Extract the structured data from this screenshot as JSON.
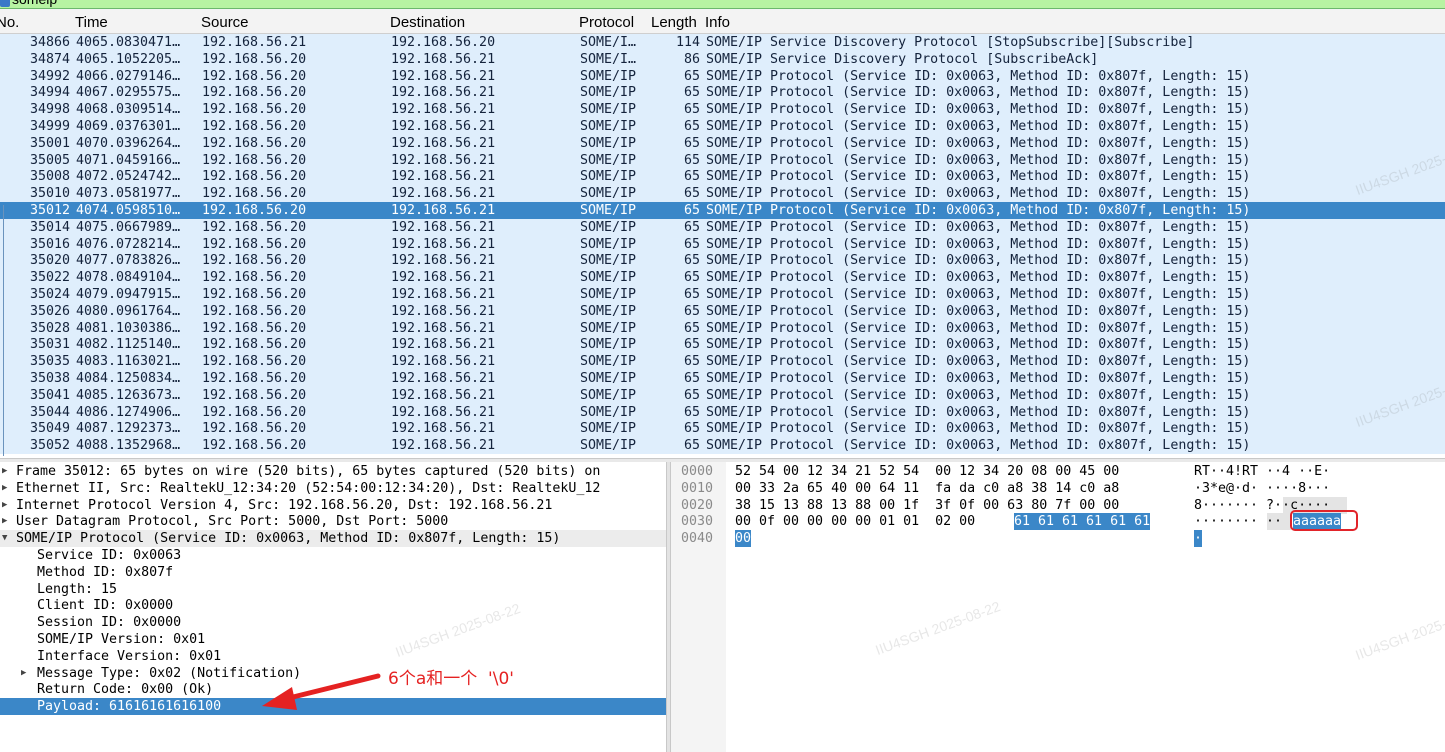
{
  "filter": {
    "value": "someip"
  },
  "columns": [
    "No.",
    "Time",
    "Source",
    "Destination",
    "Protocol",
    "Length",
    "Info"
  ],
  "packets": [
    {
      "no": "34866",
      "time": "4065.0830471…",
      "src": "192.168.56.21",
      "dst": "192.168.56.20",
      "proto": "SOME/I…",
      "len": "114",
      "info": "SOME/IP Service Discovery Protocol [StopSubscribe][Subscribe]"
    },
    {
      "no": "34874",
      "time": "4065.1052205…",
      "src": "192.168.56.20",
      "dst": "192.168.56.21",
      "proto": "SOME/I…",
      "len": "86",
      "info": "SOME/IP Service Discovery Protocol [SubscribeAck]"
    },
    {
      "no": "34992",
      "time": "4066.0279146…",
      "src": "192.168.56.20",
      "dst": "192.168.56.21",
      "proto": "SOME/IP",
      "len": "65",
      "info": "SOME/IP Protocol (Service ID: 0x0063, Method ID: 0x807f, Length: 15)"
    },
    {
      "no": "34994",
      "time": "4067.0295575…",
      "src": "192.168.56.20",
      "dst": "192.168.56.21",
      "proto": "SOME/IP",
      "len": "65",
      "info": "SOME/IP Protocol (Service ID: 0x0063, Method ID: 0x807f, Length: 15)"
    },
    {
      "no": "34998",
      "time": "4068.0309514…",
      "src": "192.168.56.20",
      "dst": "192.168.56.21",
      "proto": "SOME/IP",
      "len": "65",
      "info": "SOME/IP Protocol (Service ID: 0x0063, Method ID: 0x807f, Length: 15)"
    },
    {
      "no": "34999",
      "time": "4069.0376301…",
      "src": "192.168.56.20",
      "dst": "192.168.56.21",
      "proto": "SOME/IP",
      "len": "65",
      "info": "SOME/IP Protocol (Service ID: 0x0063, Method ID: 0x807f, Length: 15)"
    },
    {
      "no": "35001",
      "time": "4070.0396264…",
      "src": "192.168.56.20",
      "dst": "192.168.56.21",
      "proto": "SOME/IP",
      "len": "65",
      "info": "SOME/IP Protocol (Service ID: 0x0063, Method ID: 0x807f, Length: 15)"
    },
    {
      "no": "35005",
      "time": "4071.0459166…",
      "src": "192.168.56.20",
      "dst": "192.168.56.21",
      "proto": "SOME/IP",
      "len": "65",
      "info": "SOME/IP Protocol (Service ID: 0x0063, Method ID: 0x807f, Length: 15)"
    },
    {
      "no": "35008",
      "time": "4072.0524742…",
      "src": "192.168.56.20",
      "dst": "192.168.56.21",
      "proto": "SOME/IP",
      "len": "65",
      "info": "SOME/IP Protocol (Service ID: 0x0063, Method ID: 0x807f, Length: 15)"
    },
    {
      "no": "35010",
      "time": "4073.0581977…",
      "src": "192.168.56.20",
      "dst": "192.168.56.21",
      "proto": "SOME/IP",
      "len": "65",
      "info": "SOME/IP Protocol (Service ID: 0x0063, Method ID: 0x807f, Length: 15)"
    },
    {
      "no": "35012",
      "time": "4074.0598510…",
      "src": "192.168.56.20",
      "dst": "192.168.56.21",
      "proto": "SOME/IP",
      "len": "65",
      "info": "SOME/IP Protocol (Service ID: 0x0063, Method ID: 0x807f, Length: 15)"
    },
    {
      "no": "35014",
      "time": "4075.0667989…",
      "src": "192.168.56.20",
      "dst": "192.168.56.21",
      "proto": "SOME/IP",
      "len": "65",
      "info": "SOME/IP Protocol (Service ID: 0x0063, Method ID: 0x807f, Length: 15)"
    },
    {
      "no": "35016",
      "time": "4076.0728214…",
      "src": "192.168.56.20",
      "dst": "192.168.56.21",
      "proto": "SOME/IP",
      "len": "65",
      "info": "SOME/IP Protocol (Service ID: 0x0063, Method ID: 0x807f, Length: 15)"
    },
    {
      "no": "35020",
      "time": "4077.0783826…",
      "src": "192.168.56.20",
      "dst": "192.168.56.21",
      "proto": "SOME/IP",
      "len": "65",
      "info": "SOME/IP Protocol (Service ID: 0x0063, Method ID: 0x807f, Length: 15)"
    },
    {
      "no": "35022",
      "time": "4078.0849104…",
      "src": "192.168.56.20",
      "dst": "192.168.56.21",
      "proto": "SOME/IP",
      "len": "65",
      "info": "SOME/IP Protocol (Service ID: 0x0063, Method ID: 0x807f, Length: 15)"
    },
    {
      "no": "35024",
      "time": "4079.0947915…",
      "src": "192.168.56.20",
      "dst": "192.168.56.21",
      "proto": "SOME/IP",
      "len": "65",
      "info": "SOME/IP Protocol (Service ID: 0x0063, Method ID: 0x807f, Length: 15)"
    },
    {
      "no": "35026",
      "time": "4080.0961764…",
      "src": "192.168.56.20",
      "dst": "192.168.56.21",
      "proto": "SOME/IP",
      "len": "65",
      "info": "SOME/IP Protocol (Service ID: 0x0063, Method ID: 0x807f, Length: 15)"
    },
    {
      "no": "35028",
      "time": "4081.1030386…",
      "src": "192.168.56.20",
      "dst": "192.168.56.21",
      "proto": "SOME/IP",
      "len": "65",
      "info": "SOME/IP Protocol (Service ID: 0x0063, Method ID: 0x807f, Length: 15)"
    },
    {
      "no": "35031",
      "time": "4082.1125140…",
      "src": "192.168.56.20",
      "dst": "192.168.56.21",
      "proto": "SOME/IP",
      "len": "65",
      "info": "SOME/IP Protocol (Service ID: 0x0063, Method ID: 0x807f, Length: 15)"
    },
    {
      "no": "35035",
      "time": "4083.1163021…",
      "src": "192.168.56.20",
      "dst": "192.168.56.21",
      "proto": "SOME/IP",
      "len": "65",
      "info": "SOME/IP Protocol (Service ID: 0x0063, Method ID: 0x807f, Length: 15)"
    },
    {
      "no": "35038",
      "time": "4084.1250834…",
      "src": "192.168.56.20",
      "dst": "192.168.56.21",
      "proto": "SOME/IP",
      "len": "65",
      "info": "SOME/IP Protocol (Service ID: 0x0063, Method ID: 0x807f, Length: 15)"
    },
    {
      "no": "35041",
      "time": "4085.1263673…",
      "src": "192.168.56.20",
      "dst": "192.168.56.21",
      "proto": "SOME/IP",
      "len": "65",
      "info": "SOME/IP Protocol (Service ID: 0x0063, Method ID: 0x807f, Length: 15)"
    },
    {
      "no": "35044",
      "time": "4086.1274906…",
      "src": "192.168.56.20",
      "dst": "192.168.56.21",
      "proto": "SOME/IP",
      "len": "65",
      "info": "SOME/IP Protocol (Service ID: 0x0063, Method ID: 0x807f, Length: 15)"
    },
    {
      "no": "35049",
      "time": "4087.1292373…",
      "src": "192.168.56.20",
      "dst": "192.168.56.21",
      "proto": "SOME/IP",
      "len": "65",
      "info": "SOME/IP Protocol (Service ID: 0x0063, Method ID: 0x807f, Length: 15)"
    },
    {
      "no": "35052",
      "time": "4088.1352968…",
      "src": "192.168.56.20",
      "dst": "192.168.56.21",
      "proto": "SOME/IP",
      "len": "65",
      "info": "SOME/IP Protocol (Service ID: 0x0063, Method ID: 0x807f, Length: 15)"
    }
  ],
  "selected_packet_index": 10,
  "details": [
    {
      "text": "Frame 35012: 65 bytes on wire (520 bits), 65 bytes captured (520 bits) on",
      "level": 0,
      "arrow": "collapsed"
    },
    {
      "text": "Ethernet II, Src: RealtekU_12:34:20 (52:54:00:12:34:20), Dst: RealtekU_12",
      "level": 0,
      "arrow": "collapsed"
    },
    {
      "text": "Internet Protocol Version 4, Src: 192.168.56.20, Dst: 192.168.56.21",
      "level": 0,
      "arrow": "collapsed"
    },
    {
      "text": "User Datagram Protocol, Src Port: 5000, Dst Port: 5000",
      "level": 0,
      "arrow": "collapsed"
    },
    {
      "text": "SOME/IP Protocol (Service ID: 0x0063, Method ID: 0x807f, Length: 15)",
      "level": 0,
      "arrow": "expanded"
    },
    {
      "text": "Service ID: 0x0063",
      "level": 1,
      "arrow": "none"
    },
    {
      "text": "Method ID: 0x807f",
      "level": 1,
      "arrow": "none"
    },
    {
      "text": "Length: 15",
      "level": 1,
      "arrow": "none"
    },
    {
      "text": "Client ID: 0x0000",
      "level": 1,
      "arrow": "none"
    },
    {
      "text": "Session ID: 0x0000",
      "level": 1,
      "arrow": "none"
    },
    {
      "text": "SOME/IP Version: 0x01",
      "level": 1,
      "arrow": "none"
    },
    {
      "text": "Interface Version: 0x01",
      "level": 1,
      "arrow": "none"
    },
    {
      "text": "Message Type: 0x02 (Notification)",
      "level": 1,
      "arrow": "collapsed"
    },
    {
      "text": "Return Code: 0x00 (Ok)",
      "level": 1,
      "arrow": "none"
    },
    {
      "text": "Payload: 61616161616100",
      "level": 1,
      "arrow": "none"
    }
  ],
  "selected_detail_index": 14,
  "bytes": [
    {
      "offset": "0000",
      "hex": "52 54 00 12 34 21 52 54  00 12 34 20 08 00 45 00",
      "ascii": "RT··4!RT ··4 ··E·",
      "hex_sel": "",
      "ascii_sel": ""
    },
    {
      "offset": "0010",
      "hex": "00 33 2a 65 40 00 64 11  fa da c0 a8 38 14 c0 a8",
      "ascii": "·3*e@·d· ····8···",
      "hex_sel": "",
      "ascii_sel": ""
    },
    {
      "offset": "0020",
      "hex": "38 15 13 88 13 88 00 1f  3f 0f 00 63 80 7f 00 00",
      "ascii": "8······· ?··c····",
      "hex_sel": "",
      "ascii_sel": ""
    },
    {
      "offset": "0030",
      "hex": "00 0f 00 00 00 00 01 01  02 00 ",
      "ascii": "········ ··",
      "hex_sel": "61 61 61 61 61 61",
      "ascii_sel": "aaaaaa"
    },
    {
      "offset": "0040",
      "hex": "",
      "ascii": "",
      "hex_sel": "00",
      "ascii_sel": "·"
    }
  ],
  "annotation": {
    "text": "6个a和一个  '\\0'"
  },
  "watermark": {
    "text": "IIU4SGH  2025-08-22"
  },
  "colors": {
    "row_bg": "#dfeefc",
    "selected_bg": "#3b87c8",
    "annotation_red": "#e52222"
  }
}
